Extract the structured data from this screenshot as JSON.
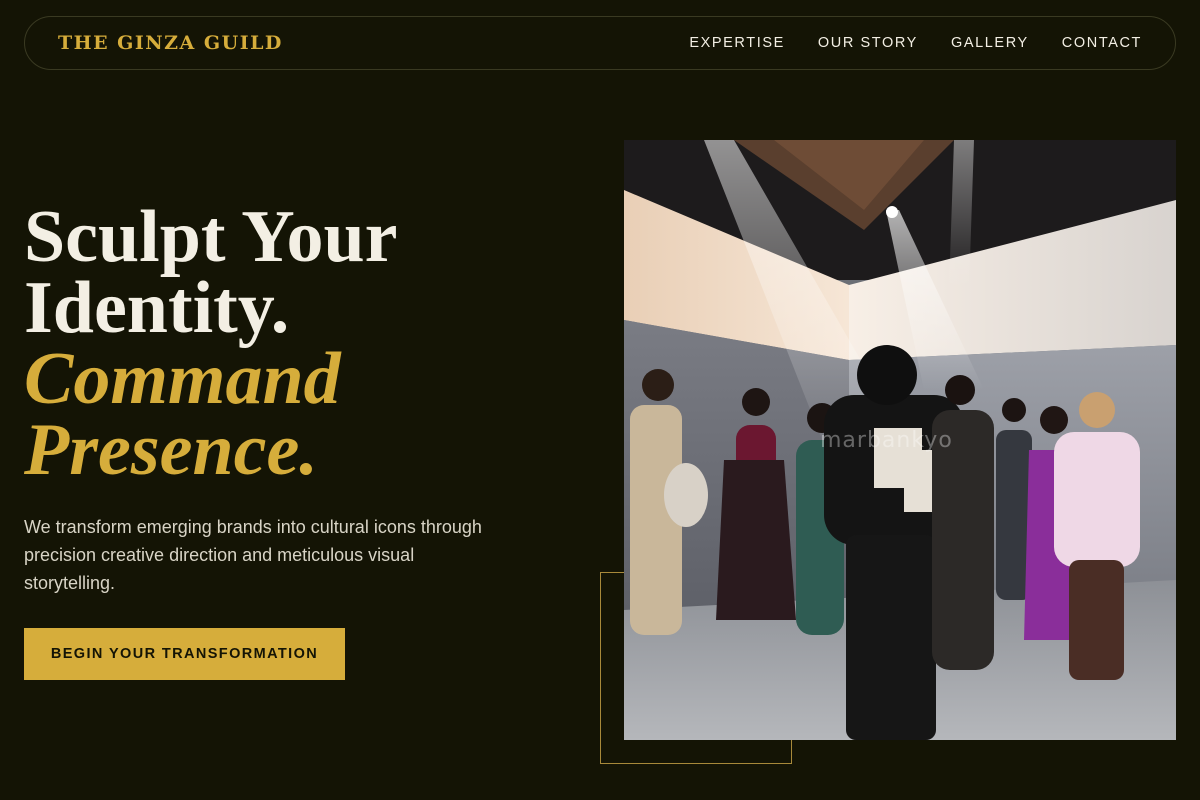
{
  "brand": {
    "name": "THE GINZA GUILD"
  },
  "nav": {
    "items": [
      {
        "label": "EXPERTISE"
      },
      {
        "label": "OUR STORY"
      },
      {
        "label": "GALLERY"
      },
      {
        "label": "CONTACT"
      }
    ]
  },
  "hero": {
    "headline_line1": "Sculpt Your",
    "headline_line2": "Identity.",
    "headline_line3": "Command",
    "headline_line4": "Presence.",
    "description": "We transform emerging brands into cultural icons through precision creative direction and meticulous visual storytelling.",
    "cta_label": "BEGIN YOUR TRANSFORMATION"
  },
  "photo": {
    "watermark": "marbankyo"
  },
  "colors": {
    "background": "#141405",
    "accent": "#d6ad3b",
    "text": "#f3efe4"
  }
}
